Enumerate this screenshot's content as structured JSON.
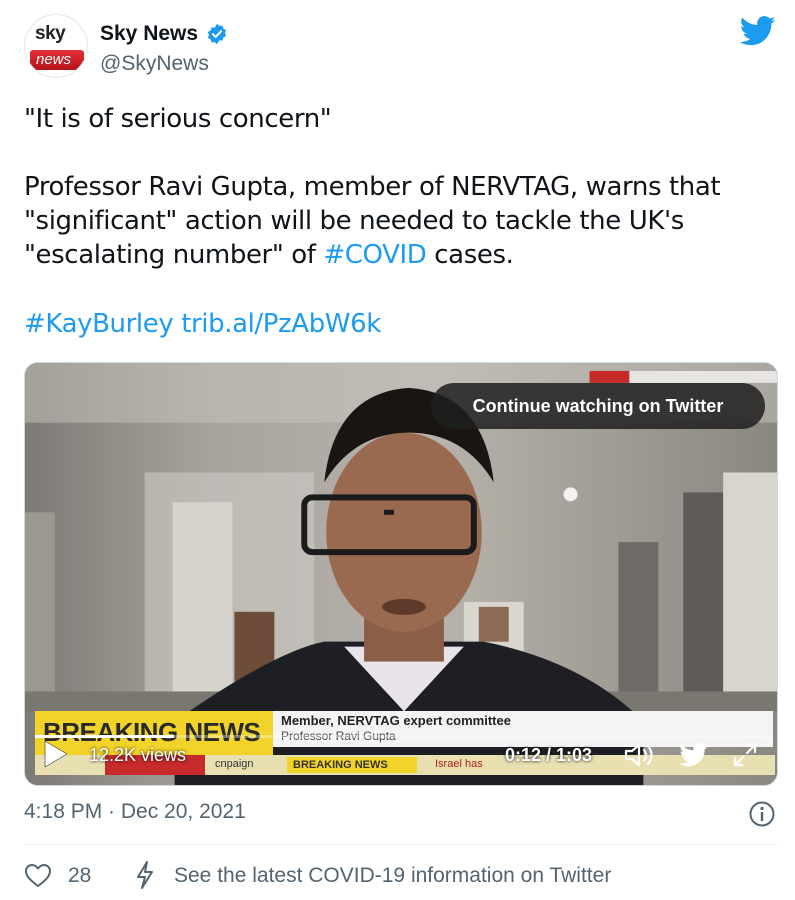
{
  "account": {
    "avatar_top": "sky",
    "avatar_bottom": "news",
    "name": "Sky News",
    "handle": "@SkyNews",
    "verified": true
  },
  "tweet": {
    "line1": "\"It is of serious concern\"",
    "body_prefix": "Professor Ravi Gupta, member of NERVTAG, warns that \"significant\" action will be needed to tackle the UK's \"escalating number\" of ",
    "hashtag_covid": "#COVID",
    "body_suffix": " cases.",
    "hashtag_kay": "#KayBurley",
    "link": "trib.al/PzAbW6k"
  },
  "media": {
    "continue_label": "Continue watching on Twitter",
    "breaking_label": "BREAKING NEWS",
    "caption_role": "Member, NERVTAG expert committee",
    "caption_name": "Professor Ravi Gupta",
    "ticker_left": "cnpaign",
    "ticker_breaking": "BREAKING NEWS",
    "ticker_right": "Israel has",
    "views": "12.2K views",
    "time": "0:12 / 1:03",
    "progress_fraction": 0.19
  },
  "footer": {
    "timestamp": "4:18 PM · Dec 20, 2021",
    "like_count": "28",
    "covid_info": "See the latest COVID-19 information on Twitter"
  },
  "colors": {
    "link": "#1d9bf0",
    "text": "#0f1419",
    "muted": "#536471"
  },
  "icons": [
    "verified-badge-icon",
    "twitter-bird-icon",
    "play-icon",
    "volume-icon",
    "fullscreen-icon",
    "info-icon",
    "heart-icon",
    "bolt-icon"
  ]
}
